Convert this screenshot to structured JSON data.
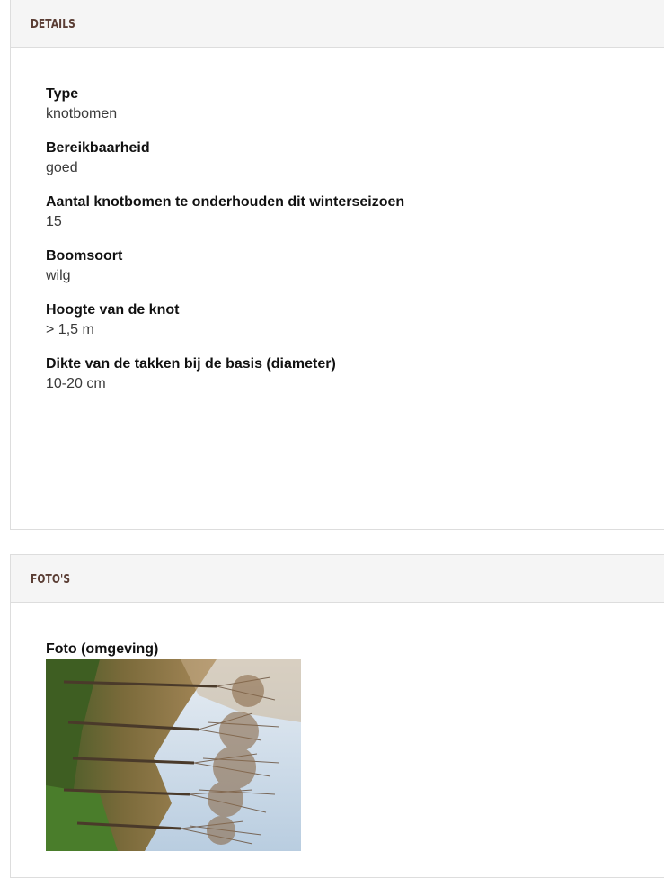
{
  "details": {
    "title": "DETAILS",
    "fields": [
      {
        "label": "Type",
        "value": "knotbomen"
      },
      {
        "label": "Bereikbaarheid",
        "value": "goed"
      },
      {
        "label": "Aantal knotbomen te onderhouden dit winterseizoen",
        "value": "15"
      },
      {
        "label": "Boomsoort",
        "value": "wilg"
      },
      {
        "label": "Hoogte van de knot",
        "value": "> 1,5 m"
      },
      {
        "label": "Dikte van de takken bij de basis (diameter)",
        "value": "10-20 cm"
      }
    ]
  },
  "photos": {
    "title": "FOTO'S",
    "items": [
      {
        "label": "Foto (omgeving)",
        "image": "photo of pollarded willow trees"
      }
    ]
  },
  "colors": {
    "header_background": "#f5f5f5",
    "header_text": "#5a3d34",
    "border": "#dddddd"
  }
}
